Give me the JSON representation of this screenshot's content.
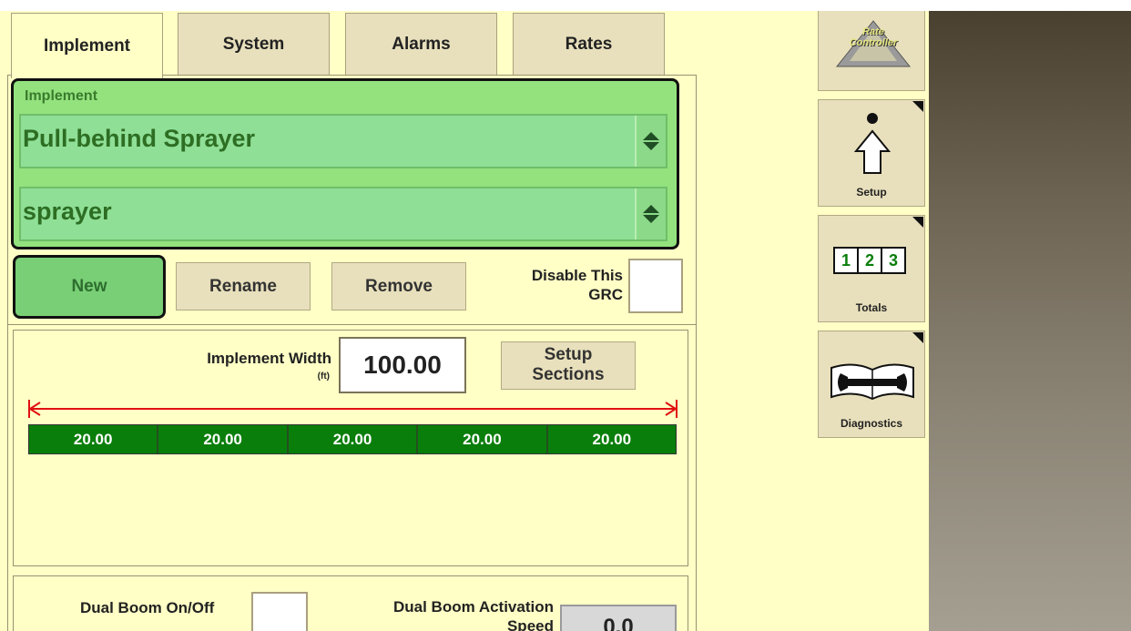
{
  "tabs": [
    {
      "label": "Implement",
      "active": true
    },
    {
      "label": "System",
      "active": false
    },
    {
      "label": "Alarms",
      "active": false
    },
    {
      "label": "Rates",
      "active": false
    }
  ],
  "implement_group": {
    "label": "Implement",
    "type_value": "Pull-behind Sprayer",
    "name_value": "sprayer"
  },
  "actions": {
    "new_label": "New",
    "rename_label": "Rename",
    "remove_label": "Remove",
    "disable_grc_label_line1": "Disable This",
    "disable_grc_label_line2": "GRC",
    "disable_grc_checked": false
  },
  "implement_width": {
    "label": "Implement Width",
    "unit": "(ft)",
    "value": "100.00",
    "setup_sections_line1": "Setup",
    "setup_sections_line2": "Sections"
  },
  "sections": [
    "20.00",
    "20.00",
    "20.00",
    "20.00",
    "20.00"
  ],
  "dual_boom": {
    "onoff_label": "Dual Boom On/Off",
    "onoff_checked": false,
    "activation_label_line1": "Dual Boom Activation",
    "activation_label_line2": "Speed",
    "activation_value": "0.0"
  },
  "side_nav": {
    "rate_controller_logo_line1": "Rate",
    "rate_controller_logo_line2": "Controller",
    "setup_label": "Setup",
    "totals_label": "Totals",
    "totals_digits": [
      "1",
      "2",
      "3"
    ],
    "diagnostics_label": "Diagnostics"
  },
  "colors": {
    "background": "#ffffc6",
    "accent_green": "#93e27e",
    "section_green": "#0a7e0b",
    "width_arrow": "#e01010"
  },
  "icons": {
    "setup": "setup-arrow-icon",
    "totals": "totals-123-icon",
    "diagnostics": "wrench-book-icon",
    "spin": "spinner-arrows-icon"
  }
}
